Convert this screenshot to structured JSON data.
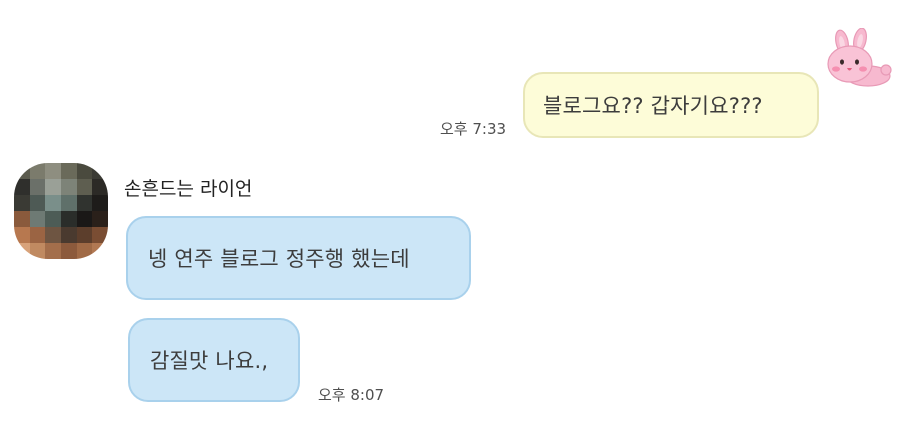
{
  "messages": {
    "outgoing": {
      "text": "블로그요?? 갑자기요???",
      "time": "오후 7:33"
    },
    "incoming": {
      "sender": "손흔드는 라이언",
      "first_text": "넹 연주 블로그 정주행 했는데",
      "second_text": "감질맛 나요.,",
      "time": "오후 8:07"
    }
  },
  "sticker": {
    "icon": "pink-bunny-sticker-icon"
  },
  "avatar": {
    "icon": "pixelated-profile-photo"
  },
  "colors": {
    "outgoing_bubble": "#fdfcd8",
    "incoming_bubble": "#cce6f7",
    "background": "#ffffff"
  }
}
